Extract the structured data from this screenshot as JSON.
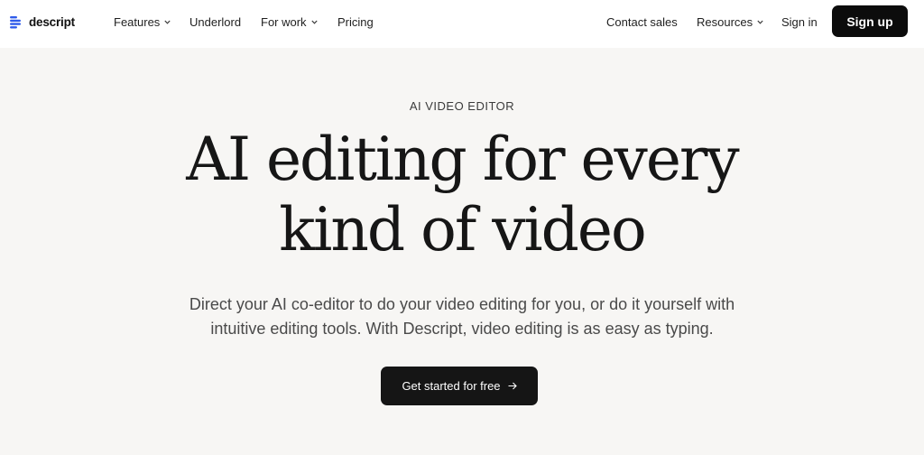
{
  "brand": {
    "name": "descript",
    "logo_icon": "descript-logo-icon"
  },
  "nav": {
    "left": [
      {
        "label": "Features",
        "dropdown": true
      },
      {
        "label": "Underlord",
        "dropdown": false
      },
      {
        "label": "For work",
        "dropdown": true
      },
      {
        "label": "Pricing",
        "dropdown": false
      }
    ],
    "right": [
      {
        "label": "Contact sales",
        "dropdown": false
      },
      {
        "label": "Resources",
        "dropdown": true
      },
      {
        "label": "Sign in",
        "dropdown": false
      }
    ],
    "signup_label": "Sign up"
  },
  "hero": {
    "eyebrow": "AI VIDEO EDITOR",
    "headline": [
      "AI editing for every",
      "kind of video"
    ],
    "subtitle": [
      "Direct your AI co-editor to do your video editing for you, or do it yourself with",
      "intuitive editing tools. With Descript, video editing is as easy as typing."
    ],
    "cta_label": "Get started for free",
    "cta_icon": "arrow-right-icon"
  },
  "colors": {
    "background": "#f7f6f4",
    "navbar": "#ffffff",
    "button_dark": "#0c0c0c",
    "logo_blue": "#2f5bea"
  }
}
